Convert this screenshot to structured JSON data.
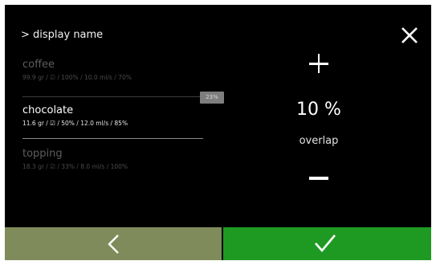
{
  "header": {
    "title": "> display name",
    "close_icon": "close-icon"
  },
  "ingredients": [
    {
      "name": "coffee",
      "detail": "99.9 gr / ☑ / 100% / 10.0 ml/s / 70%",
      "state": "dim"
    },
    {
      "name": "chocolate",
      "detail": "11.6 gr / ☑ / 50% / 12.0 ml/s / 85%",
      "state": "active"
    },
    {
      "name": "topping",
      "detail": "18.3 gr / ☑ / 33% / 8.0 ml/s / 100%",
      "state": "dim"
    }
  ],
  "overlap_badge": "23%",
  "adjust": {
    "value": "10 %",
    "label": "overlap",
    "increase_icon": "plus-icon",
    "decrease_icon": "minus-icon"
  },
  "footer": {
    "back_icon": "chevron-left-icon",
    "confirm_icon": "checkmark-icon",
    "colors": {
      "back": "#7f8b5a",
      "confirm": "#1e9a23"
    }
  }
}
